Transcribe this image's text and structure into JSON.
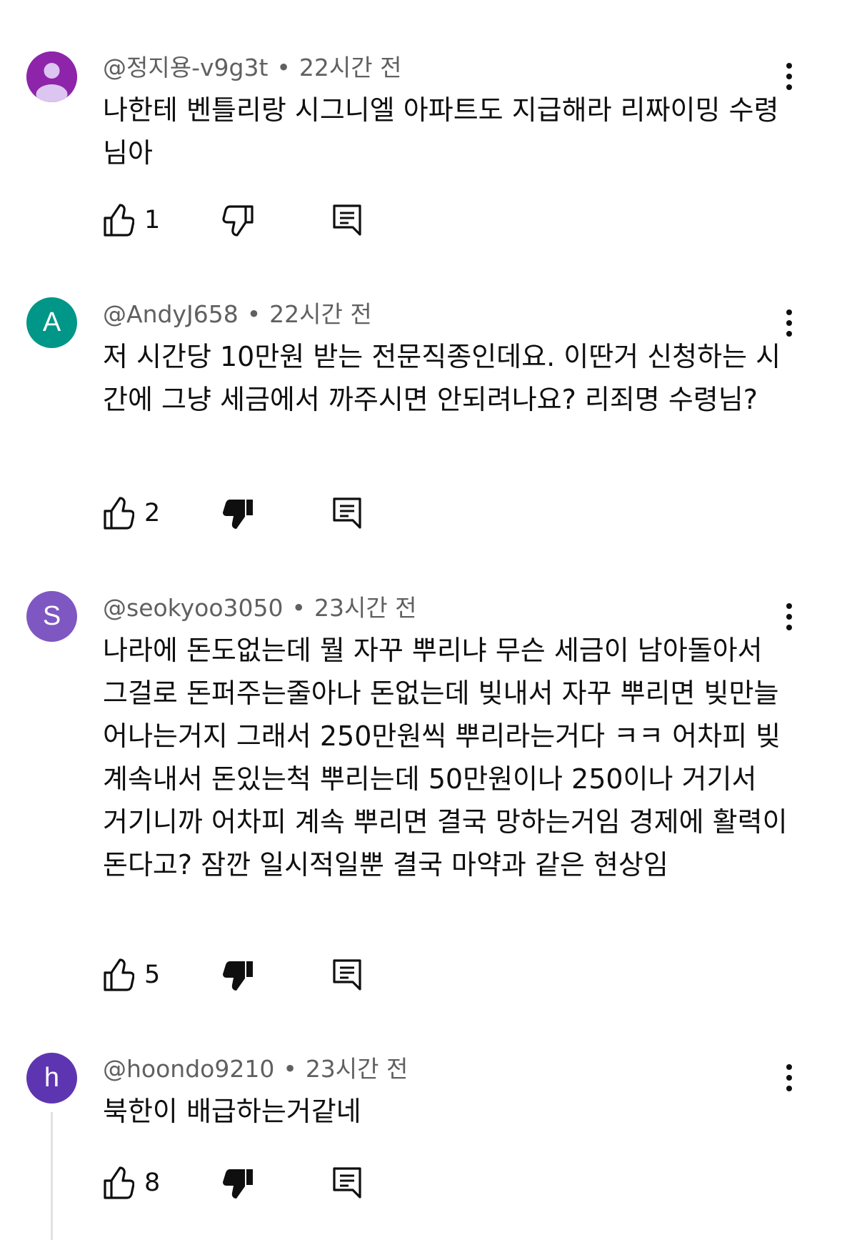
{
  "colors": {
    "avatar_c1": "#8e24aa",
    "avatar_c2": "#009688",
    "avatar_c3": "#7e57c2",
    "avatar_c4": "#5e35b1"
  },
  "icons": {
    "like": "thumbs-up-icon",
    "dislike": "thumbs-down-icon",
    "reply": "reply-icon",
    "more": "more-vertical-icon"
  },
  "comments": [
    {
      "author": "@정지용-v9g3t",
      "separator": "•",
      "time": "22시간 전",
      "text": "나한테 벤틀리랑 시그니엘 아파트도 지급해라 리짜이밍 수령님아",
      "likes": "1",
      "disliked": false,
      "avatar_letter": ""
    },
    {
      "author": "@AndyJ658",
      "separator": "•",
      "time": "22시간 전",
      "text": "저 시간당 10만원 받는 전문직종인데요. 이딴거 신청하는 시간에 그냥 세금에서 까주시면 안되려나요? 리죄명 수령님?",
      "likes": "2",
      "disliked": true,
      "avatar_letter": "A"
    },
    {
      "author": "@seokyoo3050",
      "separator": "•",
      "time": "23시간 전",
      "text": "나라에 돈도없는데 뭘 자꾸 뿌리냐 무슨 세금이 남아돌아서 그걸로 돈퍼주는줄아나 돈없는데 빚내서 자꾸 뿌리면 빚만늘어나는거지 그래서 250만원씩 뿌리라는거다 ㅋㅋ 어차피 빚계속내서 돈있는척 뿌리는데 50만원이나 250이나 거기서 거기니까 어차피 계속 뿌리면 결국 망하는거임 경제에 활력이 돈다고? 잠깐 일시적일뿐 결국 마약과 같은 현상임",
      "likes": "5",
      "disliked": true,
      "avatar_letter": "S"
    },
    {
      "author": "@hoondo9210",
      "separator": "•",
      "time": "23시간 전",
      "text": "북한이 배급하는거같네",
      "likes": "8",
      "disliked": true,
      "avatar_letter": "h"
    }
  ]
}
